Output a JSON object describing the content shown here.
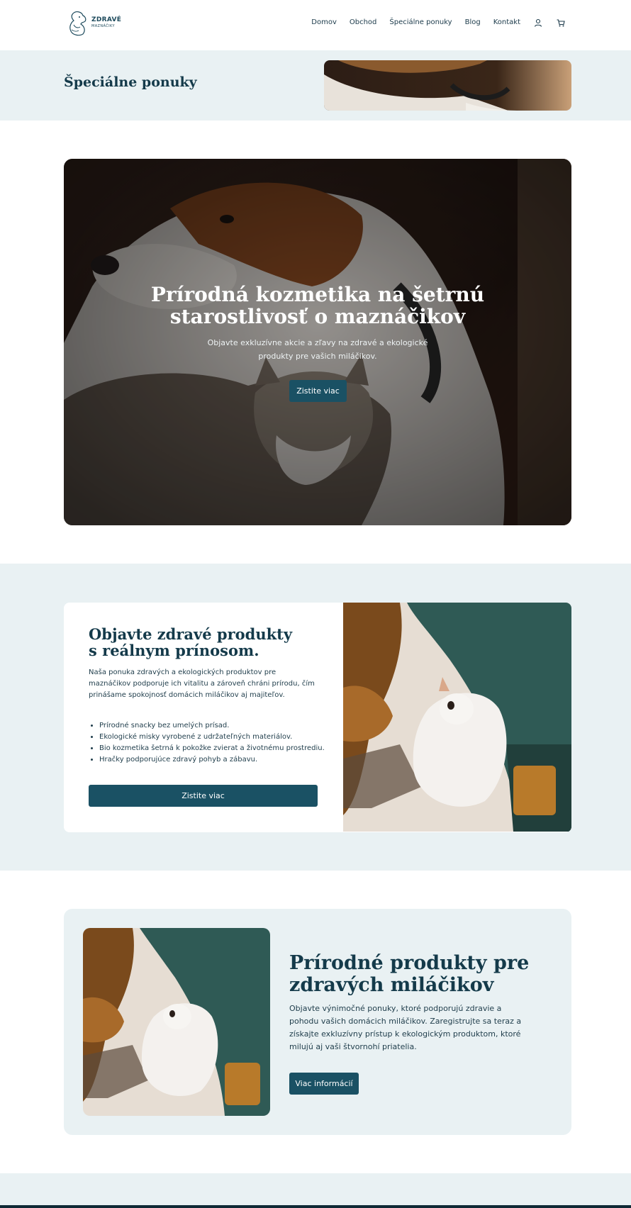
{
  "brand": {
    "name_line1": "ZDRAVÉ",
    "name_line2": "MAZNÁČIKY",
    "logo_icon": "dog-cat-logo-icon",
    "accent_color": "#1a5164",
    "background_tint": "#e9f1f3"
  },
  "nav": {
    "items": [
      {
        "label": "Domov"
      },
      {
        "label": "Obchod"
      },
      {
        "label": "Špeciálne ponuky"
      },
      {
        "label": "Blog"
      },
      {
        "label": "Kontakt"
      }
    ],
    "account_icon": "user-icon",
    "cart_icon": "cart-icon"
  },
  "page_header": {
    "title": "Špeciálne ponuky"
  },
  "hero": {
    "title": "Prírodná kozmetika na šetrnú starostlivosť o maznáčikov",
    "subtitle": "Objavte exkluzívne akcie a zľavy na zdravé a ekologické produkty pre vašich miláčikov.",
    "button_label": "Zistite viac"
  },
  "feature": {
    "title_line1": "Objavte zdravé produkty",
    "title_line2": "s reálnym prínosom.",
    "text": "Naša ponuka zdravých a ekologických produktov pre maznáčikov podporuje ich vitalitu a zároveň chráni prírodu, čím prinášame spokojnosť domácich miláčikov aj majiteľov.",
    "bullets": [
      "Prírodné snacky bez umelých prísad.",
      "Ekologické misky vyrobené z udržateľných materiálov.",
      "Bio kozmetika šetrná k pokožke zvierat a životnému prostrediu.",
      "Hračky podporujúce zdravý pohyb a zábavu."
    ],
    "button_label": "Zistite viac"
  },
  "promo": {
    "title": "Prírodné produkty pre zdravých miláčikov",
    "text": "Objavte výnimočné ponuky, ktoré podporujú zdravie a pohodu vašich domácich miláčikov. Zaregistrujte sa teraz a získajte exkluzívny prístup k ekologickým produktom, ktoré milujú aj vaši štvornohí priatelia.",
    "button_label": "Viac informácií"
  }
}
